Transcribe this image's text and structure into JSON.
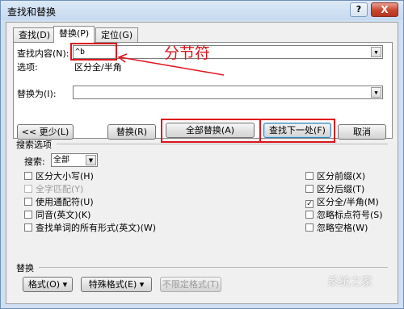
{
  "window": {
    "title": "查找和替换",
    "help_glyph": "?",
    "close_glyph": "X"
  },
  "tabs": [
    {
      "label": "查找(D)",
      "active": false
    },
    {
      "label": "替换(P)",
      "active": true
    },
    {
      "label": "定位(G)",
      "active": false
    }
  ],
  "find": {
    "label": "查找内容(N):",
    "value": "^b",
    "options_label": "选项:",
    "options_value": "区分全/半角"
  },
  "replace": {
    "label": "替换为(I):",
    "value": ""
  },
  "annotation": {
    "text": "分节符",
    "color": "#e0141c"
  },
  "buttons": {
    "less": "<< 更少(L)",
    "replace": "替换(R)",
    "replace_all": "全部替换(A)",
    "find_next": "查找下一处(F)",
    "cancel": "取消"
  },
  "search_options": {
    "group_label": "搜索选项",
    "search_label": "搜索:",
    "search_value": "全部",
    "left": [
      {
        "label": "区分大小写(H)",
        "checked": false,
        "disabled": false
      },
      {
        "label": "全字匹配(Y)",
        "checked": false,
        "disabled": true
      },
      {
        "label": "使用通配符(U)",
        "checked": false,
        "disabled": false
      },
      {
        "label": "同音(英文)(K)",
        "checked": false,
        "disabled": false
      },
      {
        "label": "查找单词的所有形式(英文)(W)",
        "checked": false,
        "disabled": false
      }
    ],
    "right": [
      {
        "label": "区分前缀(X)",
        "checked": false
      },
      {
        "label": "区分后缀(T)",
        "checked": false
      },
      {
        "label": "区分全/半角(M)",
        "checked": true
      },
      {
        "label": "忽略标点符号(S)",
        "checked": false
      },
      {
        "label": "忽略空格(W)",
        "checked": false
      }
    ]
  },
  "replace_section": {
    "label": "替换",
    "format": "格式(O) ▾",
    "special": "特殊格式(E) ▾",
    "no_format": "不限定格式(T)"
  },
  "watermark": "系统之家"
}
